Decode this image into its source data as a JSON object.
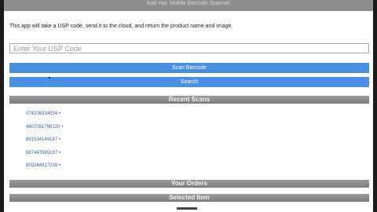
{
  "header": {
    "title": "Kati Hat, Mobile Barcode Scanner"
  },
  "intro_text": "This app will take a USP code, send it to the cloud, and return the product name and image.",
  "usp_input": {
    "placeholder": "Enter Your USP Code",
    "value": ""
  },
  "buttons": {
    "scan_label": "Scan Barcode",
    "search_label": "Search"
  },
  "sections": {
    "recent_scans": "Recent Scans",
    "your_orders": "Your Orders",
    "selected_item": "Selected Item"
  },
  "recent_scans": [
    {
      "code": "074108334534"
    },
    {
      "code": "4607051798120"
    },
    {
      "code": "891534149187"
    },
    {
      "code": "887447565197"
    },
    {
      "code": "803244917239"
    }
  ],
  "bullet_glyph": "•",
  "colors": {
    "button_blue": "#4a90e2",
    "section_gray": "#8c8c8c",
    "link_blue": "#3b57a8"
  }
}
